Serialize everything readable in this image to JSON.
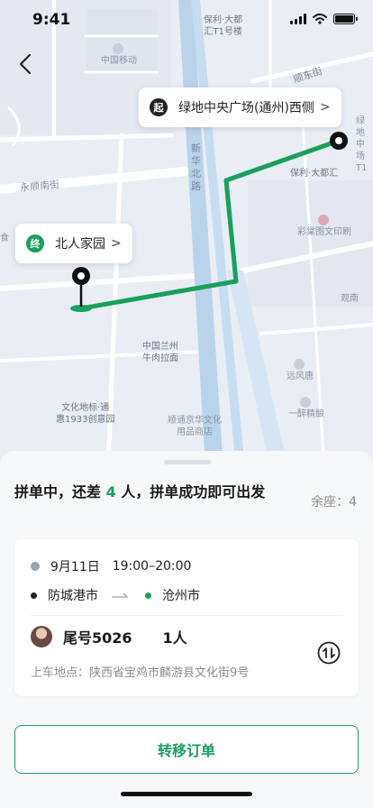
{
  "status": {
    "time": "9:41"
  },
  "map": {
    "start_badge": "起",
    "start_label": "绿地中央广场(通州)西侧",
    "end_badge": "终",
    "end_label": "北人家园",
    "chevron": ">",
    "places": {
      "mobile": "中国移动",
      "baoli_huitong": "保利·大都\n汇T1号楼",
      "baoli_duhui": "保利·大都汇",
      "xinhua_road": "新\n华\n北\n路",
      "yongshun_street": "永顺南街",
      "caitang": "彩棠图文印刷",
      "lanzhou_noodle": "中国兰州\n牛肉拉面",
      "wenhua_1933": "文化地标·通\n惠1933创意园",
      "shunjing": "顺通京华文化\n用品商店",
      "yuanfeng": "远风唐",
      "yizuijing": "一醉精酿",
      "guanjing": "观南",
      "side_food": "食",
      "shundong": "顺东街",
      "right_edge": "绿地中\n场T1"
    },
    "route_color": "#1a9f5c"
  },
  "sheet": {
    "headline_prefix": "拼单中，还差 ",
    "headline_count": "4",
    "headline_suffix": " 人，拼单成功即可出发",
    "seats": "余座：4",
    "date": "9月11日",
    "time_range": "19:00–20:00",
    "from_city": "防城港市",
    "to_city": "沧州市",
    "user_tail": "尾号5026",
    "user_count": "1人",
    "pickup_label": "上车地点：",
    "pickup_address": "陕西省宝鸡市麟游县文化街9号",
    "primary_button": "转移订单"
  },
  "colors": {
    "accent": "#1a9f5c",
    "map_bg": "#e9eef5",
    "river": "#b9d3ea"
  },
  "icons": {
    "back": "chevron-left-icon",
    "clock": "clock-icon",
    "transfer": "transfer-icon",
    "signal": "signal-icon",
    "wifi": "wifi-icon",
    "battery": "battery-icon"
  }
}
